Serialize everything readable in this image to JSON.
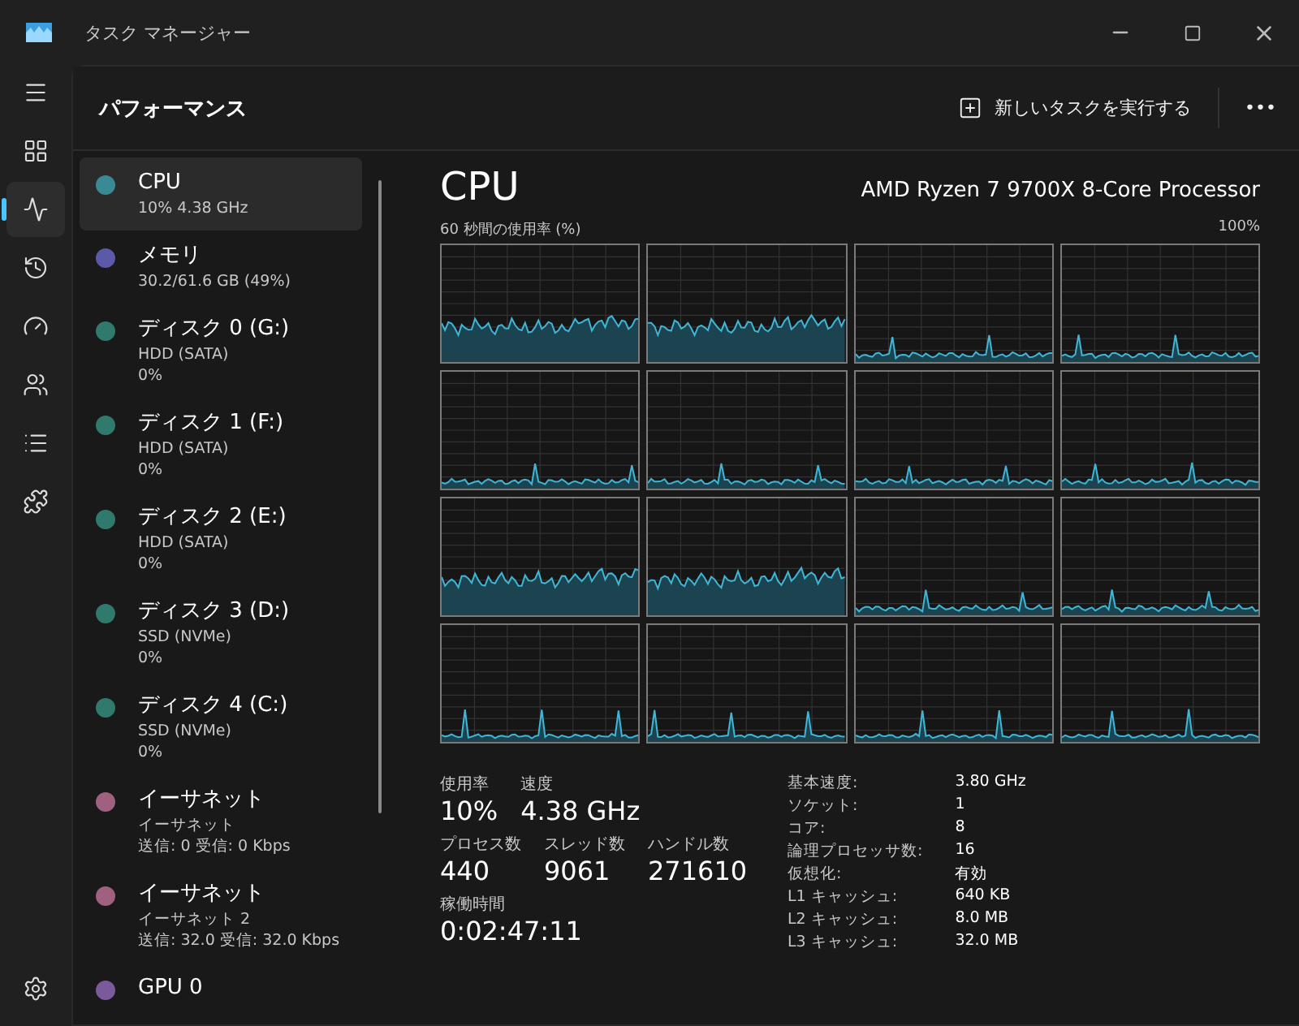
{
  "window": {
    "title": "タスク マネージャー"
  },
  "nav": [
    {
      "kind": "menu",
      "selected": false
    },
    {
      "kind": "processes",
      "selected": false
    },
    {
      "kind": "performance",
      "selected": true
    },
    {
      "kind": "history",
      "selected": false
    },
    {
      "kind": "startup",
      "selected": false
    },
    {
      "kind": "users",
      "selected": false
    },
    {
      "kind": "details",
      "selected": false
    },
    {
      "kind": "services",
      "selected": false
    },
    {
      "kind": "settings",
      "selected": false
    }
  ],
  "header": {
    "title": "パフォーマンス",
    "run_task": "新しいタスクを実行する",
    "more": "•••"
  },
  "devices": [
    {
      "name": "CPU",
      "lines": [
        "10%  4.38 GHz"
      ],
      "color": "#3a8a96",
      "selected": true
    },
    {
      "name": "メモリ",
      "lines": [
        "30.2/61.6 GB (49%)"
      ],
      "color": "#5a5aa8",
      "selected": false
    },
    {
      "name": "ディスク 0 (G:)",
      "lines": [
        "HDD (SATA)",
        "0%"
      ],
      "color": "#2f7a6c",
      "selected": false
    },
    {
      "name": "ディスク 1 (F:)",
      "lines": [
        "HDD (SATA)",
        "0%"
      ],
      "color": "#2f7a6c",
      "selected": false
    },
    {
      "name": "ディスク 2 (E:)",
      "lines": [
        "HDD (SATA)",
        "0%"
      ],
      "color": "#2f7a6c",
      "selected": false
    },
    {
      "name": "ディスク 3 (D:)",
      "lines": [
        "SSD (NVMe)",
        "0%"
      ],
      "color": "#2f7a6c",
      "selected": false
    },
    {
      "name": "ディスク 4 (C:)",
      "lines": [
        "SSD (NVMe)",
        "0%"
      ],
      "color": "#2f7a6c",
      "selected": false
    },
    {
      "name": "イーサネット",
      "lines": [
        "イーサネット",
        "送信: 0 受信: 0 Kbps"
      ],
      "color": "#a06080",
      "selected": false
    },
    {
      "name": "イーサネット",
      "lines": [
        "イーサネット 2",
        "送信: 32.0 受信: 32.0 Kbps"
      ],
      "color": "#a06080",
      "selected": false
    },
    {
      "name": "GPU 0",
      "color": "#7a5a9a",
      "selected": false
    }
  ],
  "detail": {
    "title": "CPU",
    "model": "AMD Ryzen 7 9700X 8-Core Processor",
    "graph_label": "60 秒間の使用率 (%)",
    "graph_max": "100%",
    "cores": [
      {
        "kind": "busy"
      },
      {
        "kind": "busy"
      },
      {
        "kind": "idle"
      },
      {
        "kind": "idle"
      },
      {
        "kind": "idle"
      },
      {
        "kind": "idle"
      },
      {
        "kind": "idle"
      },
      {
        "kind": "idle"
      },
      {
        "kind": "busy"
      },
      {
        "kind": "busy"
      },
      {
        "kind": "idle"
      },
      {
        "kind": "idle"
      },
      {
        "kind": "spiky"
      },
      {
        "kind": "spiky"
      },
      {
        "kind": "spiky"
      },
      {
        "kind": "spiky"
      }
    ],
    "stats": [
      [
        {
          "label": "使用率",
          "value": "10%"
        },
        {
          "label": "速度",
          "value": "4.38 GHz"
        }
      ],
      [
        {
          "label": "プロセス数",
          "value": "440"
        },
        {
          "label": "スレッド数",
          "value": "9061"
        },
        {
          "label": "ハンドル数",
          "value": "271610"
        }
      ],
      [
        {
          "label": "稼働時間",
          "value": "0:02:47:11"
        }
      ]
    ],
    "specs": [
      {
        "key": "基本速度:",
        "value": "3.80 GHz"
      },
      {
        "key": "ソケット:",
        "value": "1"
      },
      {
        "key": "コア:",
        "value": "8"
      },
      {
        "key": "論理プロセッサ数:",
        "value": "16"
      },
      {
        "key": "仮想化:",
        "value": "有効"
      },
      {
        "key": "L1 キャッシュ:",
        "value": "640 KB"
      },
      {
        "key": "L2 キャッシュ:",
        "value": "8.0 MB"
      },
      {
        "key": "L3 キャッシュ:",
        "value": "32.0 MB"
      }
    ]
  }
}
